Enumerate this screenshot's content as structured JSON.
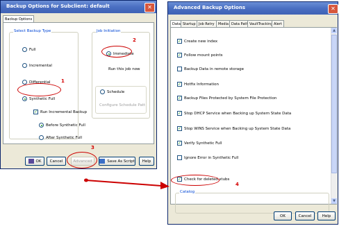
{
  "left_dialog": {
    "title": "Backup Options for Subclient: default",
    "tab": "Backup Options",
    "backup_type": {
      "title": "Select Backup Type",
      "options": [
        "Full",
        "Incremental",
        "Differential",
        "Synthetic Full"
      ],
      "selected": "Synthetic Full",
      "run_incremental": "Run Incremental Backup",
      "run_incremental_checked": true,
      "sub_options": [
        "Before Synthetic Full",
        "After Synthetic Full"
      ],
      "sub_selected": "Before Synthetic Full"
    },
    "job_initiation": {
      "title": "Job Initiation",
      "immediate": "Immediate",
      "immediate_desc": "Run this job now",
      "schedule": "Schedule",
      "configure": "Configure Schedule Patt"
    },
    "buttons": {
      "ok": "OK",
      "cancel": "Cancel",
      "advanced": "Advanced",
      "save_script": "Save As Script",
      "help": "Help"
    }
  },
  "right_dialog": {
    "title": "Advanced Backup Options",
    "tabs": [
      "Data",
      "Startup",
      "Job Retry",
      "Media",
      "Data Path",
      "VaultTracking",
      "Alert"
    ],
    "active_tab": "Data",
    "options": [
      {
        "label": "Create new index",
        "checked": true
      },
      {
        "label": "Follow mount points",
        "checked": true
      },
      {
        "label": "Backup Data in remote storage",
        "checked": false
      },
      {
        "label": "Hotfix Information",
        "checked": true
      },
      {
        "label": "Backup Files Protected by  System File Protection",
        "checked": true
      },
      {
        "label": "Stop DHCP Service when Backing up System State Data",
        "checked": true
      },
      {
        "label": "Stop WINS Service when Backing up System State Data",
        "checked": true
      },
      {
        "label": "Verify Synthetic Full",
        "checked": true
      },
      {
        "label": "Ignore Error in Synthetic Full",
        "checked": false
      },
      {
        "label": "Check for deleted stubs",
        "checked": true
      }
    ],
    "catalog_title": "Catalog",
    "buttons": {
      "ok": "OK",
      "cancel": "Cancel",
      "help": "Help"
    }
  },
  "annotations": [
    "1",
    "2",
    "3",
    "4"
  ],
  "annotation_color": "#cc0000"
}
